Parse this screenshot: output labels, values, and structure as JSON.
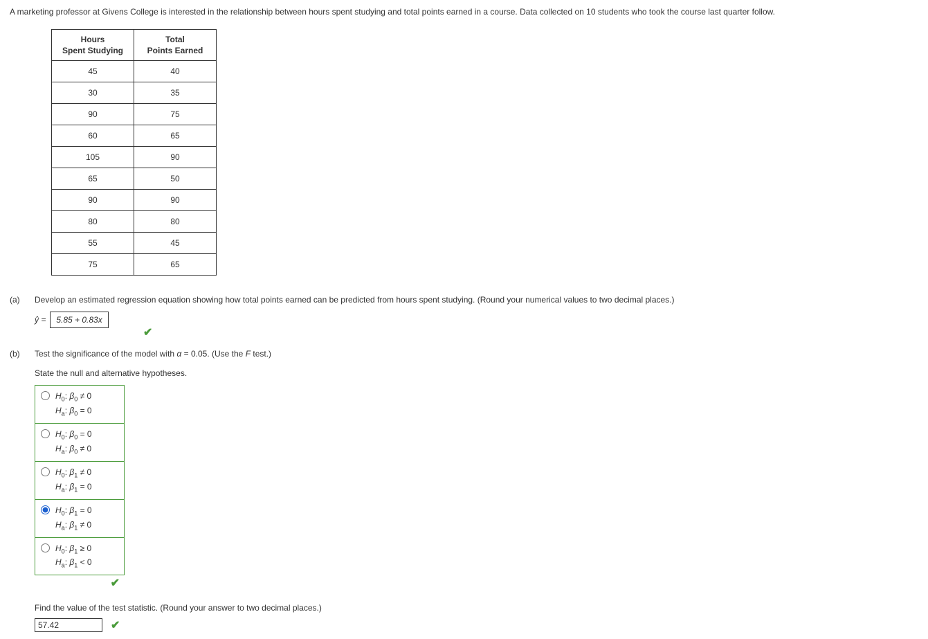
{
  "intro": "A marketing professor at Givens College is interested in the relationship between hours spent studying and total points earned in a course. Data collected on 10 students who took the course last quarter follow.",
  "table": {
    "headers": {
      "hours_l1": "Hours",
      "hours_l2": "Spent Studying",
      "points_l1": "Total",
      "points_l2": "Points Earned"
    },
    "rows": [
      {
        "hours": "45",
        "points": "40"
      },
      {
        "hours": "30",
        "points": "35"
      },
      {
        "hours": "90",
        "points": "75"
      },
      {
        "hours": "60",
        "points": "65"
      },
      {
        "hours": "105",
        "points": "90"
      },
      {
        "hours": "65",
        "points": "50"
      },
      {
        "hours": "90",
        "points": "90"
      },
      {
        "hours": "80",
        "points": "80"
      },
      {
        "hours": "55",
        "points": "45"
      },
      {
        "hours": "75",
        "points": "65"
      }
    ]
  },
  "part_a": {
    "label": "(a)",
    "prompt": "Develop an estimated regression equation showing how total points earned can be predicted from hours spent studying. (Round your numerical values to two decimal places.)",
    "lhs": "ŷ =",
    "answer": "5.85 + 0.83x"
  },
  "part_b": {
    "label": "(b)",
    "prompt_pre": "Test the significance of the model with ",
    "alpha_sym": "α",
    "prompt_mid": " = 0.05. (Use the ",
    "f_sym": "F",
    "prompt_post": " test.)",
    "hyp_prompt": "State the null and alternative hypotheses.",
    "choices": [
      {
        "h0_sub": "0",
        "beta_sub": "0",
        "h0_rel": "≠ 0",
        "ha_sub": "a",
        "ha_beta_sub": "0",
        "ha_rel": "= 0"
      },
      {
        "h0_sub": "0",
        "beta_sub": "0",
        "h0_rel": "= 0",
        "ha_sub": "a",
        "ha_beta_sub": "0",
        "ha_rel": "≠ 0"
      },
      {
        "h0_sub": "0",
        "beta_sub": "1",
        "h0_rel": "≠ 0",
        "ha_sub": "a",
        "ha_beta_sub": "1",
        "ha_rel": "= 0"
      },
      {
        "h0_sub": "0",
        "beta_sub": "1",
        "h0_rel": "= 0",
        "ha_sub": "a",
        "ha_beta_sub": "1",
        "ha_rel": "≠ 0"
      },
      {
        "h0_sub": "0",
        "beta_sub": "1",
        "h0_rel": "≥ 0",
        "ha_sub": "a",
        "ha_beta_sub": "1",
        "ha_rel": "< 0"
      }
    ],
    "selected": 3,
    "stat_prompt": "Find the value of the test statistic. (Round your answer to two decimal places.)",
    "stat_value": "57.42"
  },
  "check_glyph": "✔"
}
